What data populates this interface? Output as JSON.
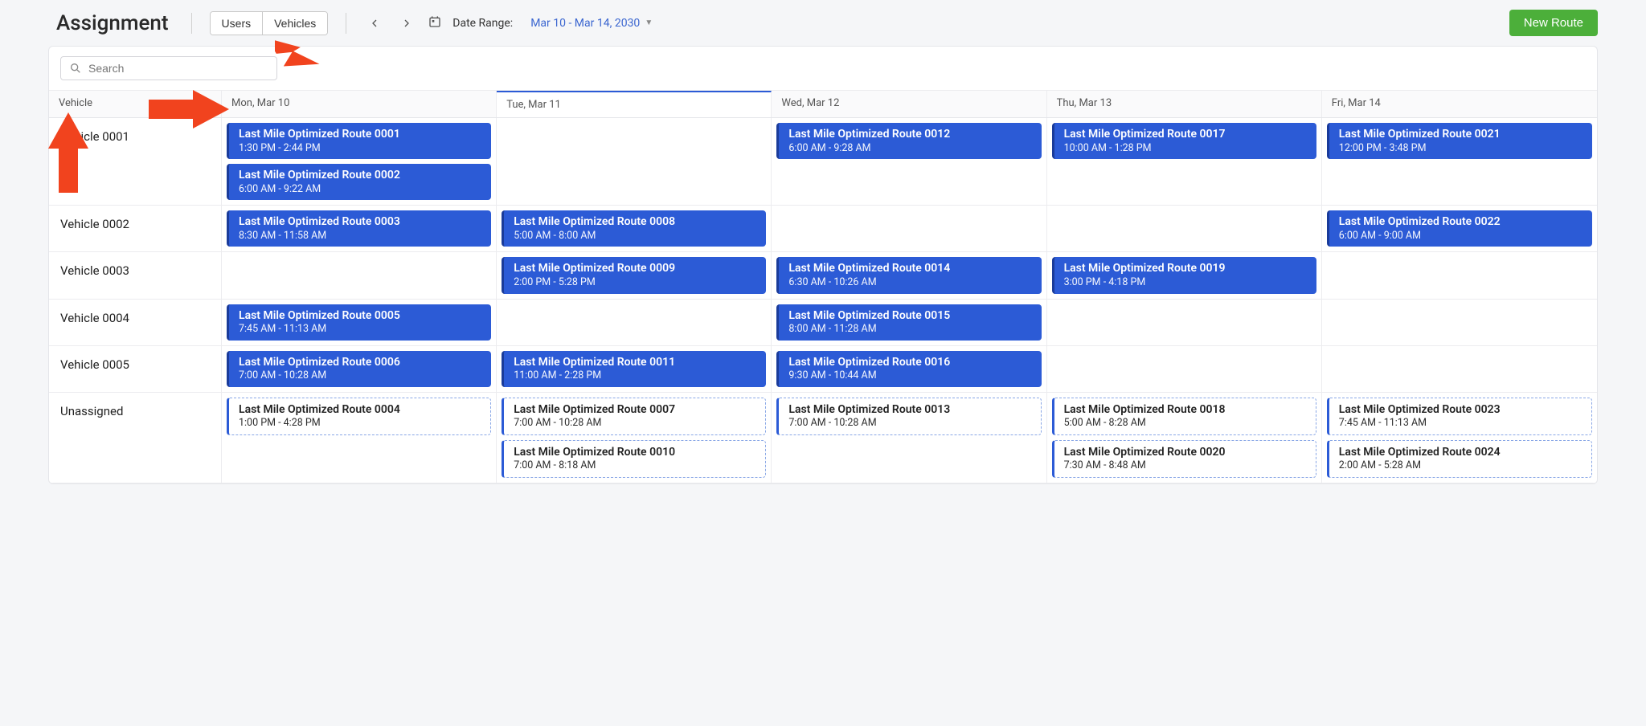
{
  "header": {
    "title": "Assignment",
    "tabs": {
      "users": "Users",
      "vehicles": "Vehicles"
    },
    "date_label": "Date Range:",
    "date_value": "Mar 10 - Mar 14, 2030",
    "new_route": "New Route"
  },
  "search": {
    "placeholder": "Search"
  },
  "columns": {
    "vehicle": "Vehicle",
    "days": [
      "Mon, Mar 10",
      "Tue, Mar 11",
      "Wed, Mar 12",
      "Thu, Mar 13",
      "Fri, Mar 14"
    ]
  },
  "rows": [
    {
      "vehicle": "Vehicle 0001",
      "cells": [
        [
          {
            "title": "Last Mile Optimized Route 0001",
            "time": "1:30 PM - 2:44 PM",
            "type": "assigned"
          },
          {
            "title": "Last Mile Optimized Route 0002",
            "time": "6:00 AM - 9:22 AM",
            "type": "assigned"
          }
        ],
        [],
        [
          {
            "title": "Last Mile Optimized Route 0012",
            "time": "6:00 AM - 9:28 AM",
            "type": "assigned"
          }
        ],
        [
          {
            "title": "Last Mile Optimized Route 0017",
            "time": "10:00 AM - 1:28 PM",
            "type": "assigned"
          }
        ],
        [
          {
            "title": "Last Mile Optimized Route 0021",
            "time": "12:00 PM - 3:48 PM",
            "type": "assigned"
          }
        ]
      ]
    },
    {
      "vehicle": "Vehicle 0002",
      "cells": [
        [
          {
            "title": "Last Mile Optimized Route 0003",
            "time": "8:30 AM - 11:58 AM",
            "type": "assigned"
          }
        ],
        [
          {
            "title": "Last Mile Optimized Route 0008",
            "time": "5:00 AM - 8:00 AM",
            "type": "assigned"
          }
        ],
        [],
        [],
        [
          {
            "title": "Last Mile Optimized Route 0022",
            "time": "6:00 AM - 9:00 AM",
            "type": "assigned"
          }
        ]
      ]
    },
    {
      "vehicle": "Vehicle 0003",
      "cells": [
        [],
        [
          {
            "title": "Last Mile Optimized Route 0009",
            "time": "2:00 PM - 5:28 PM",
            "type": "assigned"
          }
        ],
        [
          {
            "title": "Last Mile Optimized Route 0014",
            "time": "6:30 AM - 10:26 AM",
            "type": "assigned"
          }
        ],
        [
          {
            "title": "Last Mile Optimized Route 0019",
            "time": "3:00 PM - 4:18 PM",
            "type": "assigned"
          }
        ],
        []
      ]
    },
    {
      "vehicle": "Vehicle 0004",
      "cells": [
        [
          {
            "title": "Last Mile Optimized Route 0005",
            "time": "7:45 AM - 11:13 AM",
            "type": "assigned"
          }
        ],
        [],
        [
          {
            "title": "Last Mile Optimized Route 0015",
            "time": "8:00 AM - 11:28 AM",
            "type": "assigned"
          }
        ],
        [],
        []
      ]
    },
    {
      "vehicle": "Vehicle 0005",
      "cells": [
        [
          {
            "title": "Last Mile Optimized Route 0006",
            "time": "7:00 AM - 10:28 AM",
            "type": "assigned"
          }
        ],
        [
          {
            "title": "Last Mile Optimized Route 0011",
            "time": "11:00 AM - 2:28 PM",
            "type": "assigned"
          }
        ],
        [
          {
            "title": "Last Mile Optimized Route 0016",
            "time": "9:30 AM - 10:44 AM",
            "type": "assigned"
          }
        ],
        [],
        []
      ]
    },
    {
      "vehicle": "Unassigned",
      "cells": [
        [
          {
            "title": "Last Mile Optimized Route 0004",
            "time": "1:00 PM - 4:28 PM",
            "type": "unassigned"
          }
        ],
        [
          {
            "title": "Last Mile Optimized Route 0007",
            "time": "7:00 AM - 10:28 AM",
            "type": "unassigned"
          },
          {
            "title": "Last Mile Optimized Route 0010",
            "time": "7:00 AM - 8:18 AM",
            "type": "unassigned"
          }
        ],
        [
          {
            "title": "Last Mile Optimized Route 0013",
            "time": "7:00 AM - 10:28 AM",
            "type": "unassigned"
          }
        ],
        [
          {
            "title": "Last Mile Optimized Route 0018",
            "time": "5:00 AM - 8:28 AM",
            "type": "unassigned"
          },
          {
            "title": "Last Mile Optimized Route 0020",
            "time": "7:30 AM - 8:48 AM",
            "type": "unassigned"
          }
        ],
        [
          {
            "title": "Last Mile Optimized Route 0023",
            "time": "7:45 AM - 11:13 AM",
            "type": "unassigned"
          },
          {
            "title": "Last Mile Optimized Route 0024",
            "time": "2:00 AM - 5:28 AM",
            "type": "unassigned"
          }
        ]
      ]
    }
  ]
}
